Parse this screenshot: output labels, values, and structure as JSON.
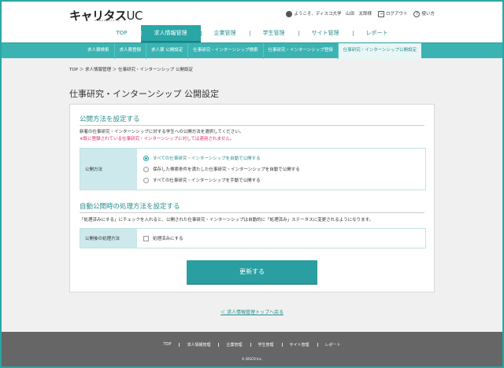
{
  "header": {
    "logo_main": "キャリタス",
    "logo_uc": "UC",
    "logo_sub": "CAREERTASUC",
    "welcome": "ようこそ、ディスコ大学　山田　太郎様",
    "logout": "ログアウト",
    "help": "使い方"
  },
  "gnav": [
    "TOP",
    "求人情報管理",
    "企業管理",
    "学生管理",
    "サイト管理",
    "レポート"
  ],
  "subnav": [
    "求人票検索",
    "求人票登録",
    "求人票 公開設定",
    "仕事研究・インターンシップ検索",
    "仕事研究・インターンシップ登録",
    "仕事研究・インターンシップ公開設定"
  ],
  "breadcrumb": "TOP ＞ 求人情報管理 ＞ 仕事研究・インターンシップ 公開設定",
  "page_title": "仕事研究・インターンシップ 公開設定",
  "section1": {
    "title": "公開方法を設定する",
    "desc": "新着の仕事研究・インターンシップに対する学生への公開方法を選択してください。",
    "note": "※既に登録されている仕事研究・インターンシップに対しては適用されません。",
    "label": "公開方法",
    "options": [
      "すべての仕事研究・インターンシップを自動で公開する",
      "保存した検索条件を満たした仕事研究・インターンシップを自動で公開する",
      "すべての仕事研究・インターンシップを手動で公開する"
    ]
  },
  "section2": {
    "title": "自動公開時の処理方法を設定する",
    "desc": "「処理済みにする」にチェックを入れると、公開された仕事研究・インターンシップは自動的に「処理済み」ステータスに変更されるようになります。",
    "label": "公開後の処理方法",
    "checkbox": "処理済みにする"
  },
  "update_button": "更新する",
  "back_link": "＜ 求人情報管理トップへ戻る",
  "footer": {
    "links": [
      "TOP",
      "求人情報管理",
      "企業管理",
      "学生管理",
      "サイト管理",
      "レポート"
    ],
    "copyright": "© DISCO Inc."
  }
}
